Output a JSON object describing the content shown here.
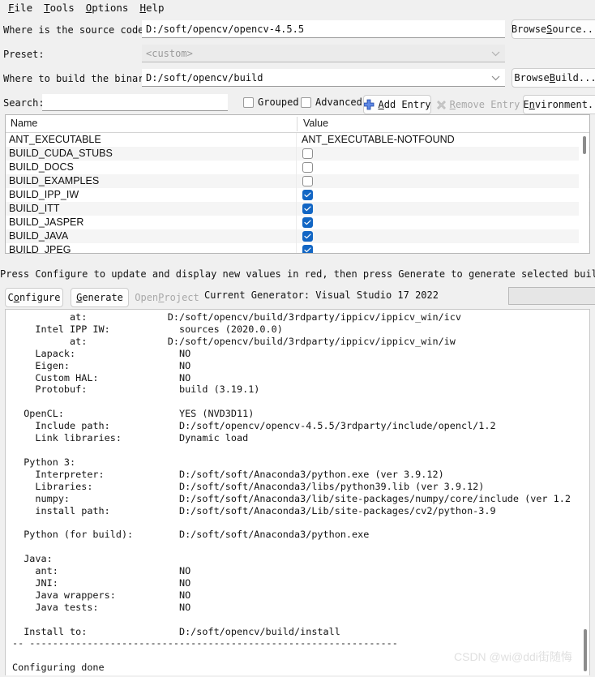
{
  "menu": {
    "items": [
      {
        "pre": "",
        "mn": "F",
        "post": "ile"
      },
      {
        "pre": "",
        "mn": "T",
        "post": "ools"
      },
      {
        "pre": "",
        "mn": "O",
        "post": "ptions"
      },
      {
        "pre": "",
        "mn": "H",
        "post": "elp"
      }
    ]
  },
  "form": {
    "source_label": "Where is the source code:",
    "source_value": "D:/soft/opencv/opencv-4.5.5",
    "browse_source": {
      "pre": "Browse ",
      "mn": "S",
      "post": "ource..."
    },
    "preset_label": "Preset:",
    "preset_value": "<custom>",
    "build_label": "Where to build the binaries:",
    "build_value": "D:/soft/opencv/build",
    "browse_build": {
      "pre": "Browse ",
      "mn": "B",
      "post": "uild..."
    },
    "search_label": {
      "pre": "",
      "mn": "S",
      "post": "earch:"
    },
    "search_value": "",
    "search_placeholder": "",
    "grouped_label": "Grouped",
    "grouped_checked": false,
    "advanced_label": "Advanced",
    "advanced_checked": false,
    "add_entry": {
      "pre": "",
      "mn": "A",
      "post": "dd Entry"
    },
    "remove_entry": {
      "pre": "",
      "mn": "R",
      "post": "emove Entry"
    },
    "remove_entry_disabled": true,
    "environment": {
      "pre": "E",
      "mn": "n",
      "post": "vironment..."
    }
  },
  "table": {
    "columns": [
      "Name",
      "Value"
    ],
    "rows": [
      {
        "name": "ANT_EXECUTABLE",
        "type": "text",
        "value": "ANT_EXECUTABLE-NOTFOUND"
      },
      {
        "name": "BUILD_CUDA_STUBS",
        "type": "checkbox",
        "checked": false
      },
      {
        "name": "BUILD_DOCS",
        "type": "checkbox",
        "checked": false
      },
      {
        "name": "BUILD_EXAMPLES",
        "type": "checkbox",
        "checked": false
      },
      {
        "name": "BUILD_IPP_IW",
        "type": "checkbox",
        "checked": true
      },
      {
        "name": "BUILD_ITT",
        "type": "checkbox",
        "checked": true
      },
      {
        "name": "BUILD_JASPER",
        "type": "checkbox",
        "checked": true
      },
      {
        "name": "BUILD_JAVA",
        "type": "checkbox",
        "checked": true
      },
      {
        "name": "BUILD_JPEG",
        "type": "checkbox",
        "checked": true
      }
    ]
  },
  "actions": {
    "hint": "Press Configure to update and display new values in red, then press Generate to generate selected build files.",
    "configure": {
      "pre": "C",
      "mn": "o",
      "post": "nfigure"
    },
    "generate": {
      "pre": "",
      "mn": "G",
      "post": "enerate"
    },
    "open_project": {
      "pre": "Open ",
      "mn": "P",
      "post": "roject"
    },
    "open_project_disabled": true,
    "current_generator": "Current Generator: Visual Studio 17 2022",
    "progress_value": ""
  },
  "log": {
    "text": "          at:              D:/soft/opencv/build/3rdparty/ippicv/ippicv_win/icv\n    Intel IPP IW:            sources (2020.0.0)\n          at:              D:/soft/opencv/build/3rdparty/ippicv/ippicv_win/iw\n    Lapack:                  NO\n    Eigen:                   NO\n    Custom HAL:              NO\n    Protobuf:                build (3.19.1)\n\n  OpenCL:                    YES (NVD3D11)\n    Include path:            D:/soft/opencv/opencv-4.5.5/3rdparty/include/opencl/1.2\n    Link libraries:          Dynamic load\n\n  Python 3:\n    Interpreter:             D:/soft/soft/Anaconda3/python.exe (ver 3.9.12)\n    Libraries:               D:/soft/soft/Anaconda3/libs/python39.lib (ver 3.9.12)\n    numpy:                   D:/soft/soft/Anaconda3/lib/site-packages/numpy/core/include (ver 1.2\n    install path:            D:/soft/soft/Anaconda3/Lib/site-packages/cv2/python-3.9\n\n  Python (for build):        D:/soft/soft/Anaconda3/python.exe\n\n  Java:\n    ant:                     NO\n    JNI:                     NO\n    Java wrappers:           NO\n    Java tests:              NO\n\n  Install to:                D:/soft/opencv/build/install\n-- ----------------------------------------------------------------\n\nConfiguring done"
  },
  "watermark": {
    "text": "CSDN @wi@ddi街随悔"
  },
  "colors": {
    "accent": "#1266c4",
    "window_bg": "#f0f0f0",
    "field_bg": "#ffffff",
    "row_alt": "#f5f5f5"
  }
}
